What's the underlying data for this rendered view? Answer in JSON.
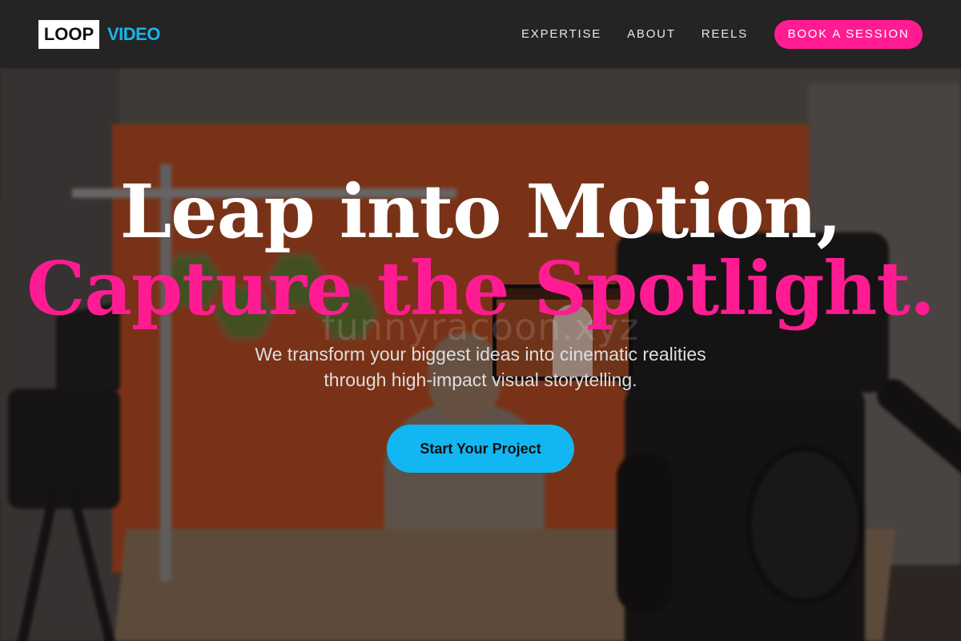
{
  "nav": {
    "logo_box": "LOOP",
    "logo_text": "VIDEO",
    "links": [
      "EXPERTISE",
      "ABOUT",
      "REELS"
    ],
    "cta_label": "BOOK A SESSION"
  },
  "hero": {
    "headline_line1": "Leap into Motion,",
    "headline_line2": "Capture the Spotlight.",
    "subtitle_line1": "We transform your biggest ideas into cinematic realities",
    "subtitle_line2": "through high-impact visual storytelling.",
    "cta_label": "Start Your Project",
    "watermark": "funnyracoon.xyz",
    "background_image": "video studio with cameras, tripod and orange wall"
  },
  "colors": {
    "navbar_bg": "#242424",
    "accent_pink": "#ff1c93",
    "accent_blue": "#12b7f2",
    "logo_blue": "#18b6ec"
  }
}
